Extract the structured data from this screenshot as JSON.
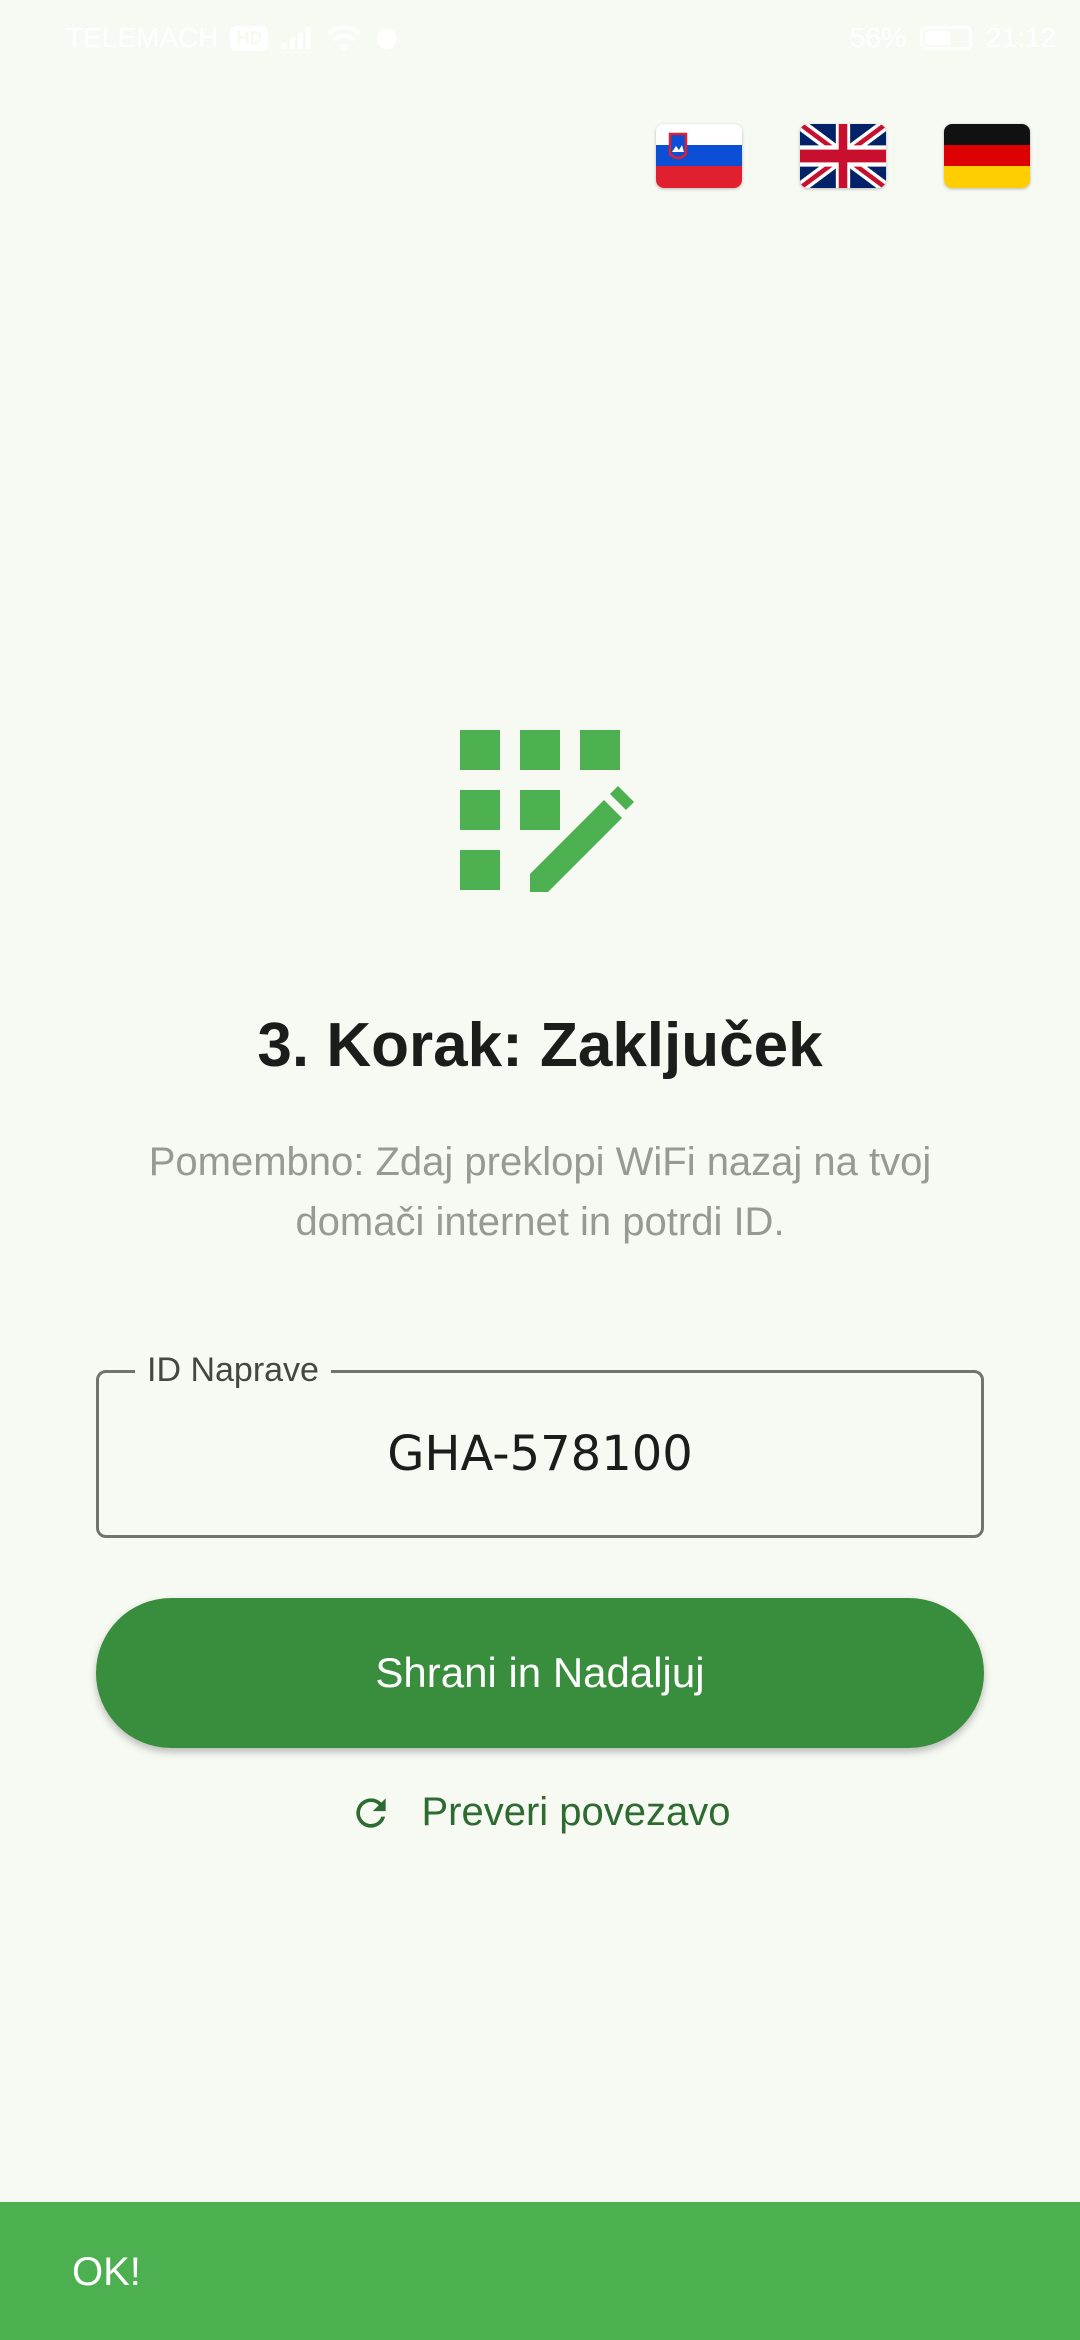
{
  "status_bar": {
    "carrier": "TELEMACH",
    "carrier_badge": "HD",
    "battery": "56%",
    "time": "21:12"
  },
  "languages": [
    {
      "code": "sl",
      "name": "Slovenščina",
      "icon": "slovenia-flag-icon"
    },
    {
      "code": "en",
      "name": "English",
      "icon": "uk-flag-icon"
    },
    {
      "code": "de",
      "name": "Deutsch",
      "icon": "germany-flag-icon"
    }
  ],
  "main": {
    "icon": "grid-edit-icon",
    "title": "3. Korak: Zaključek",
    "subtitle": "Pomembno: Zdaj preklopi WiFi nazaj na tvoj domači internet in potrdi ID.",
    "id_field": {
      "label": "ID Naprave",
      "value": "GHA-578100"
    },
    "primary_button": "Shrani in Nadaljuj",
    "text_button": "Preveri povezavo",
    "text_button_icon": "refresh-icon"
  },
  "snackbar": {
    "text": "OK!"
  },
  "colors": {
    "background": "#f7f9f3",
    "accent": "#4caf50",
    "primary_button": "#388e3c",
    "text_button": "#2e6b30"
  }
}
